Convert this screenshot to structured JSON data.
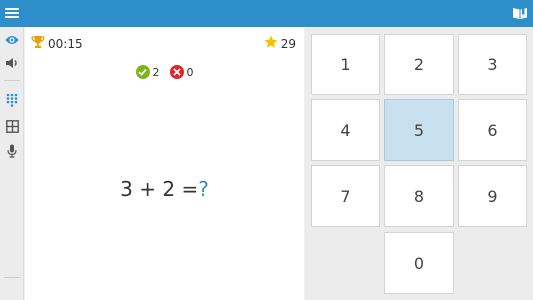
{
  "header": {
    "menu_icon": "hamburger-menu-icon",
    "book_icon": "open-book-icon",
    "bar_color": "#2e8ec9"
  },
  "sidebar": {
    "items": [
      {
        "icon": "eye-icon",
        "active": true
      },
      {
        "icon": "speaker-icon",
        "active": false
      },
      {
        "icon": "keypad-grid-icon",
        "active": true
      },
      {
        "icon": "squares-grid-icon",
        "active": false
      },
      {
        "icon": "microphone-icon",
        "active": false
      }
    ]
  },
  "game": {
    "timer": "00:15",
    "score": "29",
    "correct_count": "2",
    "wrong_count": "0",
    "problem": {
      "left": "3",
      "operator": "+",
      "right": "2",
      "equals": "=",
      "unknown": "?"
    }
  },
  "keypad": {
    "keys": [
      "1",
      "2",
      "3",
      "4",
      "5",
      "6",
      "7",
      "8",
      "9",
      "0"
    ],
    "selected_key": "5",
    "selected_color": "#c9e1ee"
  }
}
